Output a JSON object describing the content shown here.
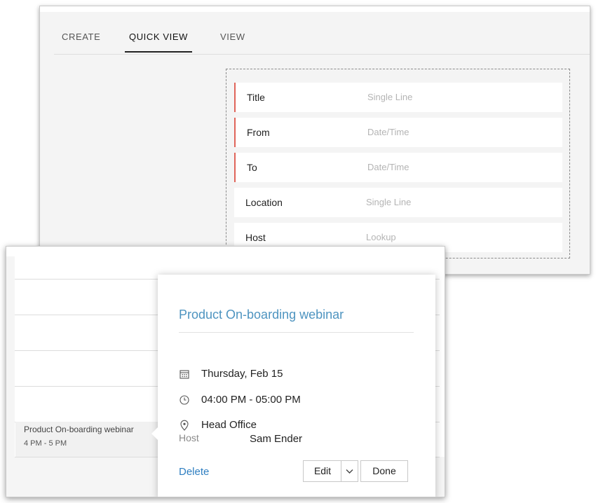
{
  "builder": {
    "tabs": [
      {
        "label": "CREATE"
      },
      {
        "label": "QUICK VIEW"
      },
      {
        "label": "VIEW"
      }
    ],
    "active_tab": "QUICK VIEW",
    "fields": [
      {
        "label": "Title",
        "type": "Single Line",
        "mandatory": true
      },
      {
        "label": "From",
        "type": "Date/Time",
        "mandatory": true
      },
      {
        "label": "To",
        "type": "Date/Time",
        "mandatory": true
      },
      {
        "label": "Location",
        "type": "Single Line",
        "mandatory": false
      },
      {
        "label": "Host",
        "type": "Lookup",
        "mandatory": false
      }
    ],
    "mandatory_color": "#e0645a"
  },
  "calendar": {
    "event": {
      "title": "Product On-boarding webinar",
      "time": "4 PM - 5 PM"
    }
  },
  "popup": {
    "title": "Product On-boarding webinar",
    "date": "Thursday, Feb 15",
    "time": "04:00 PM - 05:00 PM",
    "location": "Head Office",
    "host_label": "Host",
    "host_value": "Sam Ender",
    "delete_label": "Delete",
    "edit_label": "Edit",
    "done_label": "Done",
    "icons": {
      "date": "calendar-icon",
      "time": "clock-icon",
      "location": "location-pin-icon",
      "menu": "chevron-down-icon"
    },
    "title_color": "#4e94c0",
    "link_color": "#2f7fc1"
  }
}
